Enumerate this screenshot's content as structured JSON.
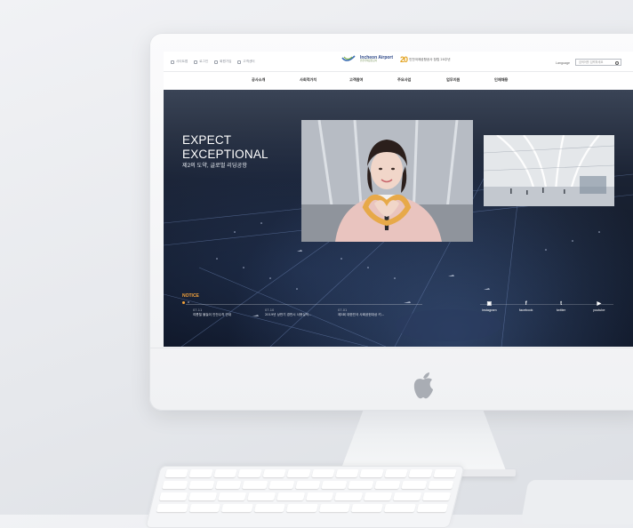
{
  "utility": [
    {
      "label": "사이트맵",
      "icon": "home-icon"
    },
    {
      "label": "로그인",
      "icon": "login-icon"
    },
    {
      "label": "회원가입",
      "icon": "member-icon"
    },
    {
      "label": "고객센터",
      "icon": "support-icon"
    }
  ],
  "logo": {
    "name": "Incheon Airport",
    "sub": "인천국제공항공사",
    "anniv_number": "20",
    "anniv_text": "인천국제공항공사 창립 20주년"
  },
  "language": "Language",
  "search": {
    "placeholder": "검색어를 입력하세요"
  },
  "nav": [
    "공사소개",
    "사회적가치",
    "고객참여",
    "주요사업",
    "업무지원",
    "인재채용"
  ],
  "hero": {
    "line1": "EXPECT",
    "line2": "EXCEPTIONAL",
    "tagline": "제2의 도약, 글로벌 리딩공항"
  },
  "notice": {
    "title": "NOTICE",
    "items": [
      {
        "date": "07.11",
        "text": "여름철 물놀이 안전수칙 안내"
      },
      {
        "date": "07.10",
        "text": "2019년 상반기 경반시 사용실적..."
      },
      {
        "date": "07.01",
        "text": "제3회 대한민국 사회공헌대상 키..."
      }
    ]
  },
  "sns": [
    {
      "label": "instagram",
      "glyph": "▣",
      "icon": "instagram-icon"
    },
    {
      "label": "facebook",
      "glyph": "f",
      "icon": "facebook-icon"
    },
    {
      "label": "twitter",
      "glyph": "t",
      "icon": "twitter-icon"
    },
    {
      "label": "youtube",
      "glyph": "▶",
      "icon": "youtube-icon"
    }
  ],
  "colors": {
    "accent": "#f4a23a",
    "brand_blue": "#2f4a8a",
    "brand_green": "#6a8a4a",
    "hero_dark": "#121a2a"
  }
}
